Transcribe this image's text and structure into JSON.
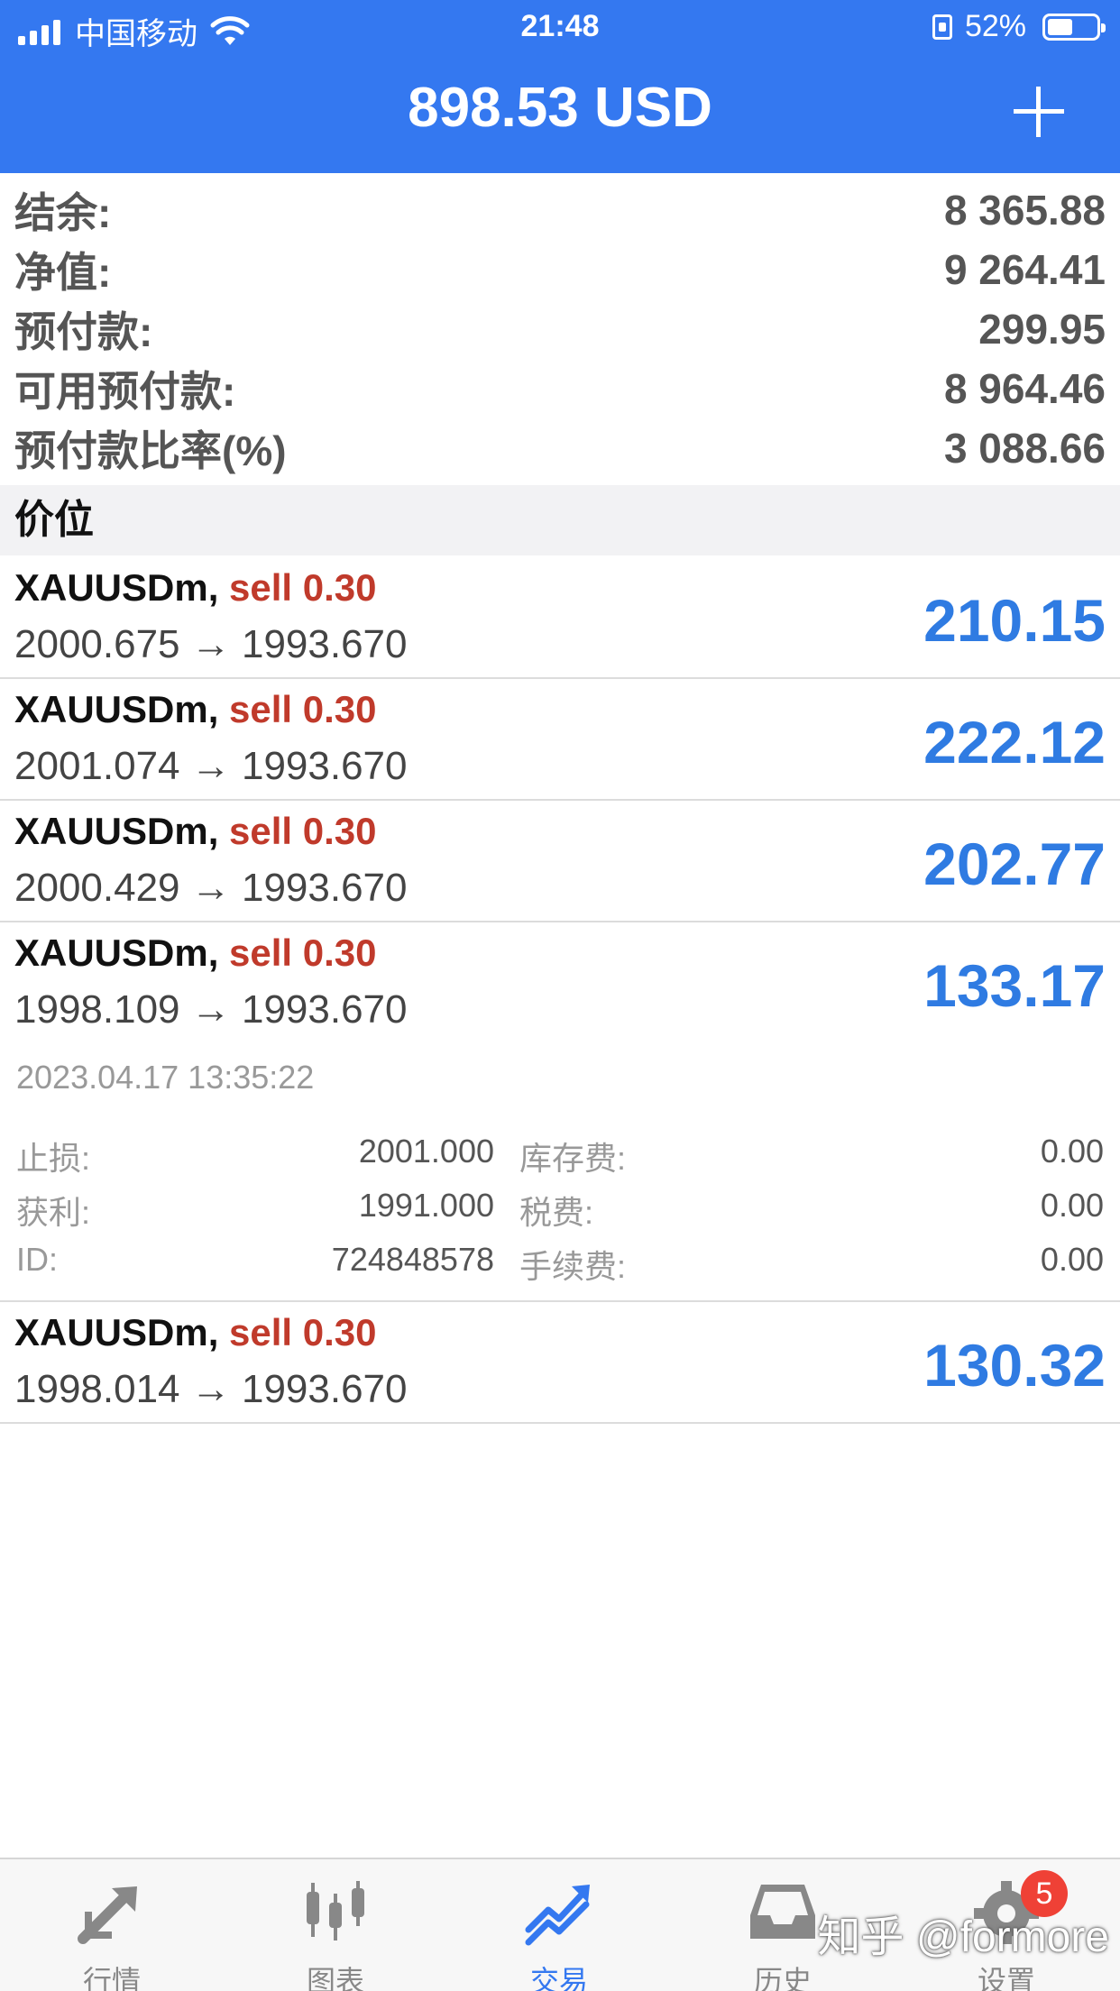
{
  "status_bar": {
    "carrier": "中国移动",
    "time": "21:48",
    "battery": "52%",
    "battery_level": 0.52
  },
  "header": {
    "title": "898.53 USD"
  },
  "summary": [
    {
      "label": "结余:",
      "value": "8 365.88"
    },
    {
      "label": "净值:",
      "value": "9 264.41"
    },
    {
      "label": "预付款:",
      "value": "299.95"
    },
    {
      "label": "可用预付款:",
      "value": "8 964.46"
    },
    {
      "label": "预付款比率(%)",
      "value": "3 088.66"
    }
  ],
  "section_title": "价位",
  "positions": [
    {
      "symbol": "XAUUSDm,",
      "order": "sell 0.30",
      "prices": "2000.675 → 1993.670",
      "profit": "210.15"
    },
    {
      "symbol": "XAUUSDm,",
      "order": "sell 0.30",
      "prices": "2001.074 → 1993.670",
      "profit": "222.12"
    },
    {
      "symbol": "XAUUSDm,",
      "order": "sell 0.30",
      "prices": "2000.429 → 1993.670",
      "profit": "202.77"
    },
    {
      "symbol": "XAUUSDm,",
      "order": "sell 0.30",
      "prices": "1998.109 → 1993.670",
      "profit": "133.17"
    },
    {
      "symbol": "XAUUSDm,",
      "order": "sell 0.30",
      "prices": "1998.014 → 1993.670",
      "profit": "130.32"
    }
  ],
  "details": {
    "time": "2023.04.17 13:35:22",
    "rows": [
      {
        "label1": "止损:",
        "value1": "2001.000",
        "label2": "库存费:",
        "value2": "0.00"
      },
      {
        "label1": "获利:",
        "value1": "1991.000",
        "label2": "税费:",
        "value2": "0.00"
      },
      {
        "label1": "ID:",
        "value1": "724848578",
        "label2": "手续费:",
        "value2": "0.00"
      }
    ]
  },
  "tabs": [
    {
      "label": "行情",
      "icon": "quotes-icon"
    },
    {
      "label": "图表",
      "icon": "chart-icon"
    },
    {
      "label": "交易",
      "icon": "trade-icon"
    },
    {
      "label": "历史",
      "icon": "history-icon"
    },
    {
      "label": "设置",
      "icon": "settings-icon",
      "badge": "5"
    }
  ],
  "watermark": "知乎 @formore",
  "colors": {
    "accent": "#3478f0",
    "sell": "#c03a2b",
    "profit": "#2f7be2",
    "badge": "#ef4136"
  }
}
